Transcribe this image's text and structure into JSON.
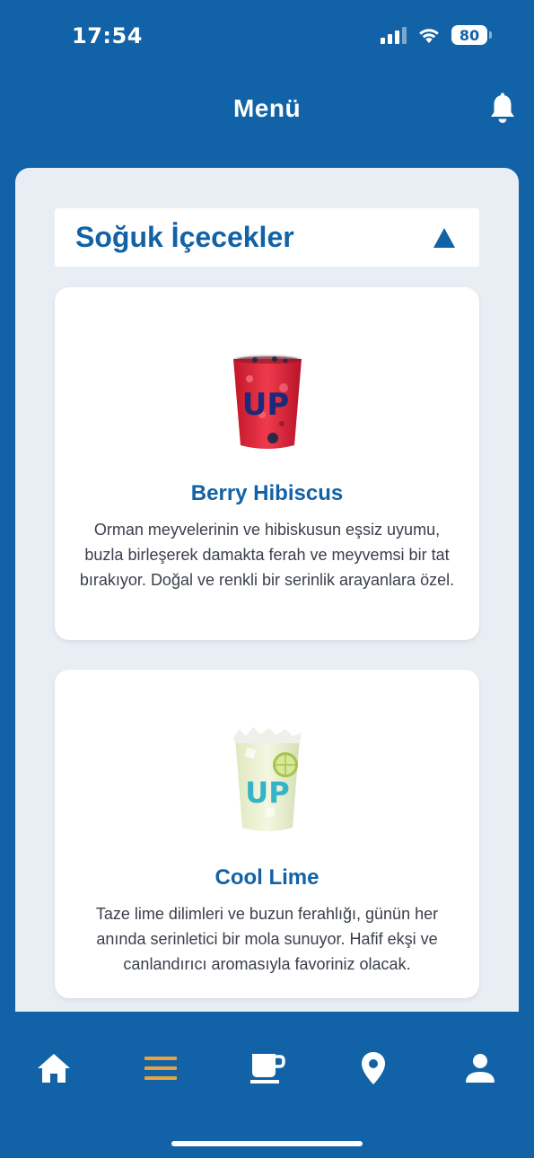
{
  "status_bar": {
    "time": "17:54",
    "battery": "80"
  },
  "header": {
    "title": "Menü"
  },
  "section": {
    "title": "Soğuk İçecekler",
    "expanded": true
  },
  "products": [
    {
      "name": "Berry Hibiscus",
      "description": "Orman meyvelerinin ve hibiskusun eşsiz uyumu, buzla birleşerek damakta ferah ve meyvemsi bir tat bırakıyor. Doğal ve renkli bir serinlik arayanlara özel.",
      "cup_logo": "UP"
    },
    {
      "name": "Cool Lime",
      "description": "Taze lime dilimleri ve buzun ferahlığı, günün her anında serinletici bir mola sunuyor. Hafif ekşi ve canlandırıcı aromasıyla favoriniz olacak.",
      "cup_logo": "UP"
    }
  ],
  "tab_bar": {
    "tabs": [
      {
        "icon": "home-icon",
        "active": false
      },
      {
        "icon": "menu-icon",
        "active": true
      },
      {
        "icon": "coffee-cup-icon",
        "active": false
      },
      {
        "icon": "location-pin-icon",
        "active": false
      },
      {
        "icon": "profile-icon",
        "active": false
      }
    ],
    "active_color": "#e8a33a"
  },
  "colors": {
    "brand": "#1162a6",
    "surface": "#e9eef5",
    "text": "#3a3f4a"
  }
}
